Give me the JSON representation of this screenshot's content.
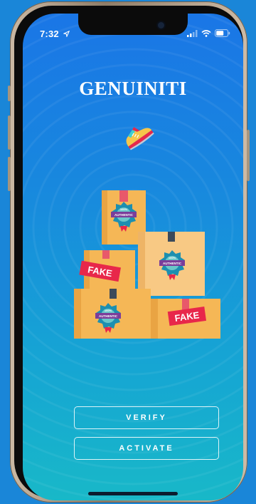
{
  "status_bar": {
    "time": "7:32",
    "location_icon": "location-arrow-icon",
    "signal_icon": "cellular-signal-icon",
    "wifi_icon": "wifi-icon",
    "battery_icon": "battery-icon"
  },
  "app": {
    "title": "GENUINITI"
  },
  "illustration": {
    "shoe_icon": "sneaker-icon",
    "stamp_top": "100%",
    "stamp_label": "AUTHENTIC",
    "fake_label": "FAKE"
  },
  "actions": {
    "verify_label": "VERIFY",
    "activate_label": "ACTIVATE"
  },
  "colors": {
    "background_top": "#1a76e6",
    "background_bottom": "#18b8c8",
    "box": "#f5b756",
    "box_dark": "#e59f3c",
    "fake_tag": "#e8274a",
    "stamp": "#1d8fb0"
  }
}
